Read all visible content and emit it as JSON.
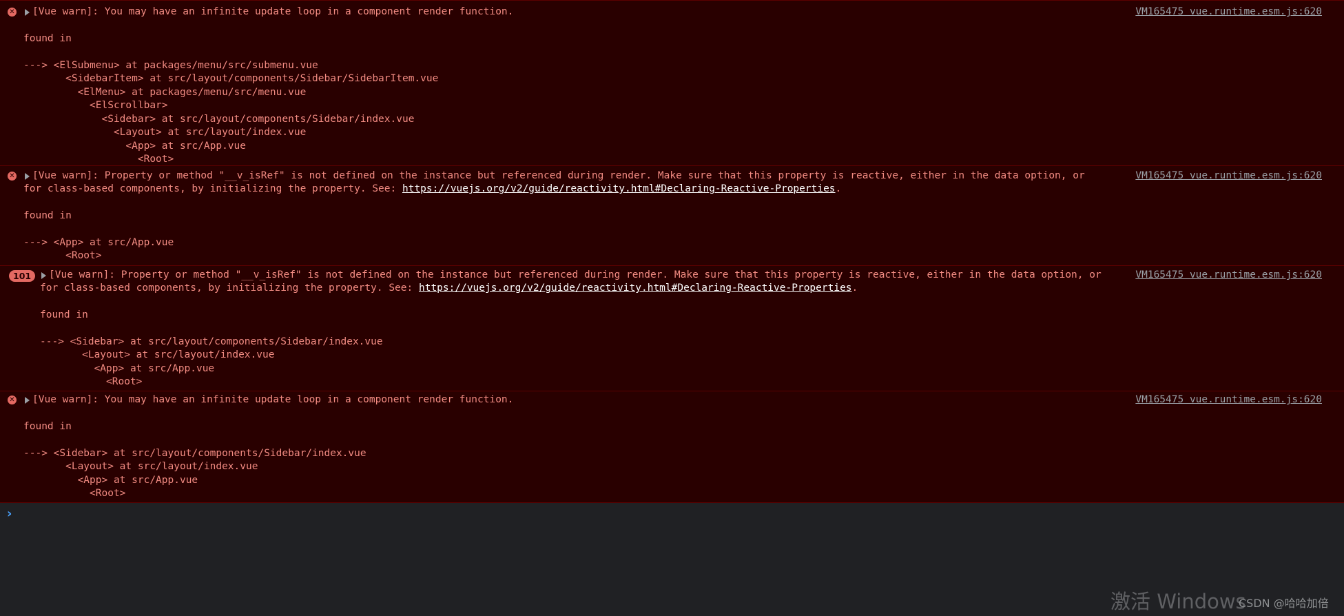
{
  "messages": [
    {
      "icon": "error-icon",
      "text": "[Vue warn]: You may have an infinite update loop in a component render function.",
      "source": "VM165475 vue.runtime.esm.js:620",
      "body": [
        "",
        "found in",
        "",
        "---> <ElSubmenu> at packages/menu/src/submenu.vue",
        "       <SidebarItem> at src/layout/components/Sidebar/SidebarItem.vue",
        "         <ElMenu> at packages/menu/src/menu.vue",
        "           <ElScrollbar>",
        "             <Sidebar> at src/layout/components/Sidebar/index.vue",
        "               <Layout> at src/layout/index.vue",
        "                 <App> at src/App.vue",
        "                   <Root>"
      ]
    },
    {
      "icon": "error-icon",
      "text_line1": "[Vue warn]: Property or method \"__v_isRef\" is not defined on the instance but referenced during render. Make sure that this property is reactive, either in the data option, or",
      "text_line2_prefix": "for class-based components, by initializing the property. See: ",
      "link": "https://vuejs.org/v2/guide/reactivity.html#Declaring-Reactive-Properties",
      "text_line2_suffix": ".",
      "source": "VM165475 vue.runtime.esm.js:620",
      "body": [
        "",
        "found in",
        "",
        "---> <App> at src/App.vue",
        "       <Root>"
      ]
    },
    {
      "count": "101",
      "text_line1": "[Vue warn]: Property or method \"__v_isRef\" is not defined on the instance but referenced during render. Make sure that this property is reactive, either in the data option, or",
      "text_line2_prefix": "for class-based components, by initializing the property. See: ",
      "link": "https://vuejs.org/v2/guide/reactivity.html#Declaring-Reactive-Properties",
      "text_line2_suffix": ".",
      "source": "VM165475 vue.runtime.esm.js:620",
      "body": [
        "",
        "found in",
        "",
        "---> <Sidebar> at src/layout/components/Sidebar/index.vue",
        "       <Layout> at src/layout/index.vue",
        "         <App> at src/App.vue",
        "           <Root>"
      ]
    },
    {
      "icon": "error-icon",
      "text": "[Vue warn]: You may have an infinite update loop in a component render function.",
      "source": "VM165475 vue.runtime.esm.js:620",
      "body": [
        "",
        "found in",
        "",
        "---> <Sidebar> at src/layout/components/Sidebar/index.vue",
        "       <Layout> at src/layout/index.vue",
        "         <App> at src/App.vue",
        "           <Root>"
      ]
    }
  ],
  "prompt": {
    "icon": "chevron-right-icon",
    "glyph": "›"
  },
  "watermark": {
    "activate_windows": "激活 Windows",
    "csdn": "CSDN @哈哈加倍"
  },
  "colors": {
    "error_bg": "#290000",
    "error_text": "#f28b82",
    "error_border": "#5c0000",
    "source_link": "#9aa0a6",
    "console_bg": "#202124",
    "prompt_accent": "#4aa3ff"
  }
}
